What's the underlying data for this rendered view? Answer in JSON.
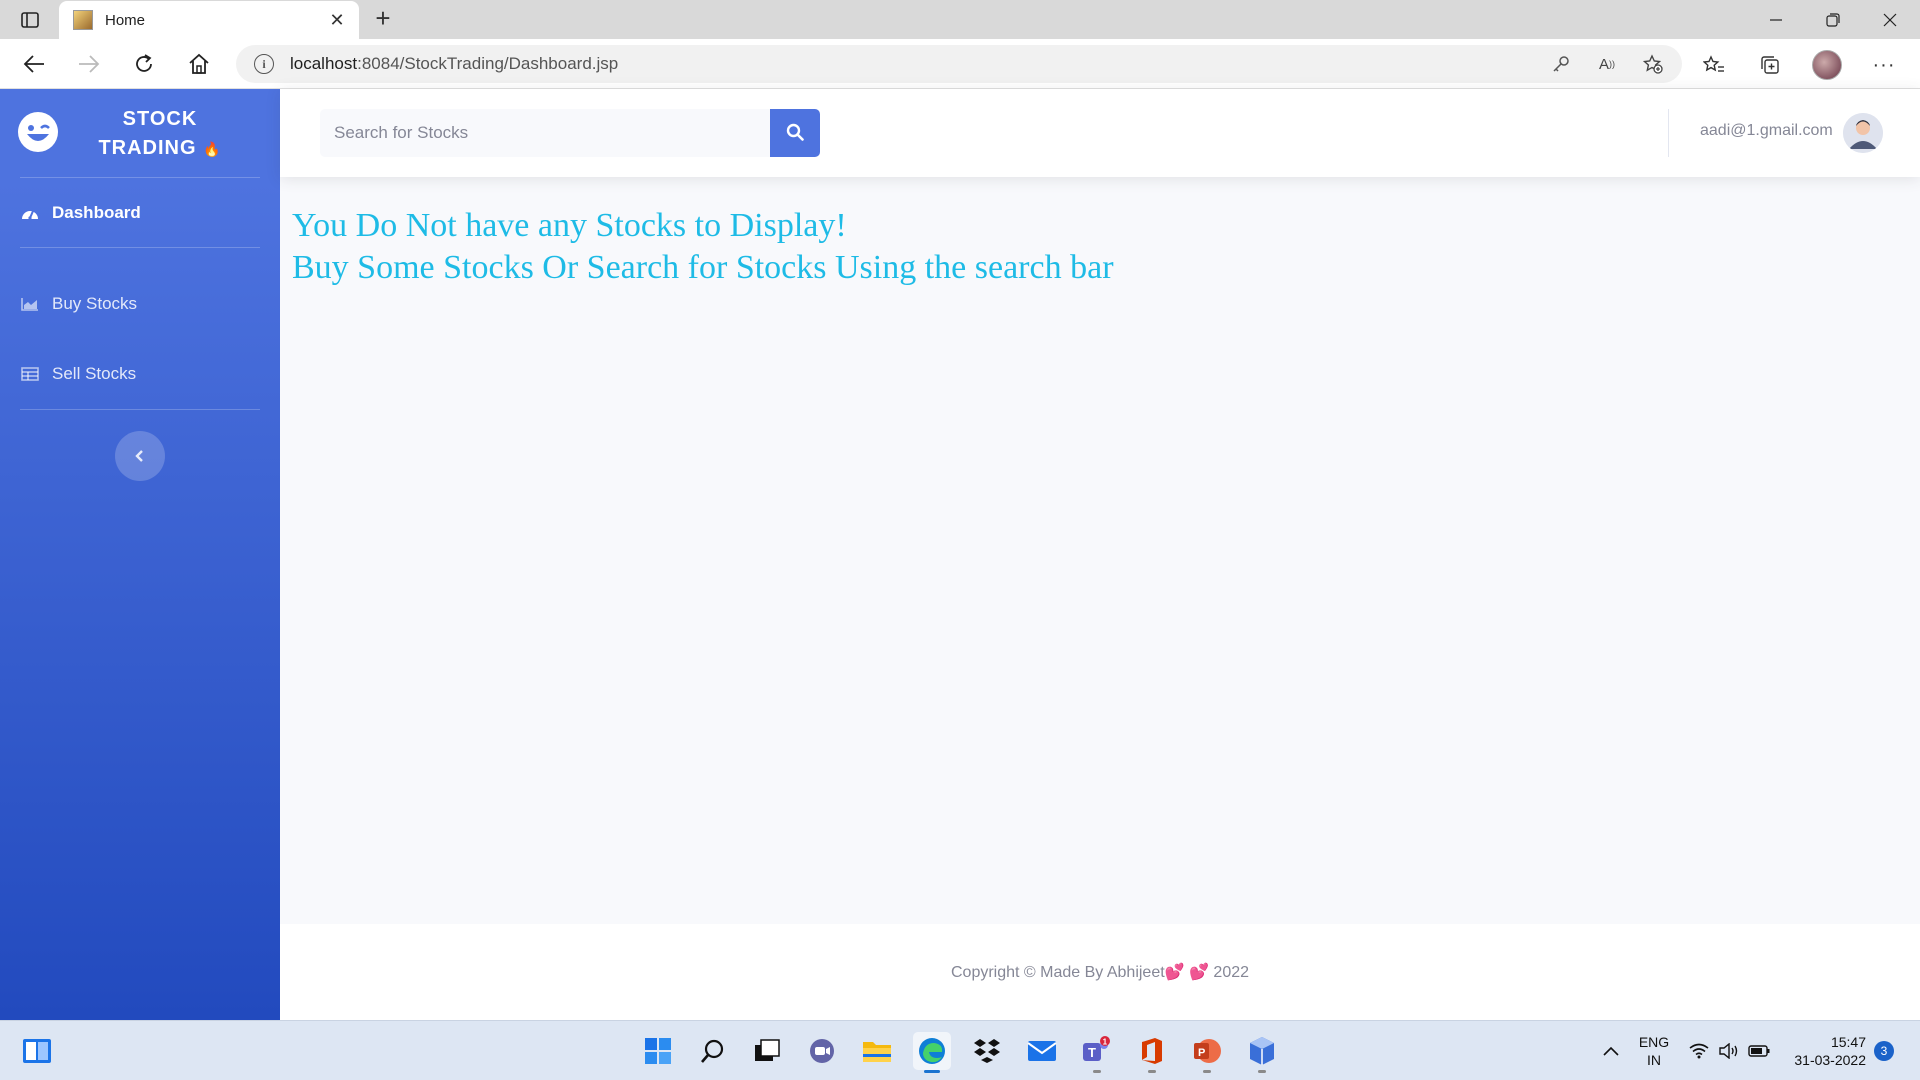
{
  "browser": {
    "tab_title": "Home",
    "url_host": "localhost",
    "url_rest": ":8084/StockTrading/Dashboard.jsp",
    "icons": [
      "tab-actions-icon",
      "close-icon",
      "new-tab-icon",
      "minimize-icon",
      "restore-icon",
      "window-close-icon",
      "back-icon",
      "forward-icon",
      "refresh-icon",
      "home-icon",
      "info-icon",
      "key-icon",
      "read-aloud-icon",
      "add-favorite-icon",
      "favorites-icon",
      "collections-icon",
      "profile-avatar",
      "more-icon"
    ]
  },
  "sidebar": {
    "brand_line1": "STOCK",
    "brand_line2": "TRADING",
    "brand_icon": "laugh-wink-icon",
    "items": [
      {
        "label": "Dashboard",
        "icon": "tachometer-icon"
      },
      {
        "label": "Buy Stocks",
        "icon": "chart-area-icon"
      },
      {
        "label": "Sell Stocks",
        "icon": "table-icon"
      }
    ],
    "toggle_icon": "chevron-left-icon",
    "colors": {
      "gradient_top": "#4e73df",
      "gradient_bottom": "#224abe"
    }
  },
  "topbar": {
    "search_placeholder": "Search for Stocks",
    "search_icon": "search-icon",
    "user_email": "aadi@1.gmail.com"
  },
  "main": {
    "message_line1": "You Do Not have any Stocks to Display!",
    "message_line2": "Buy Some Stocks Or Search for Stocks Using the search bar",
    "message_color": "#1ebbe6"
  },
  "footer": {
    "text_prefix": "Copyright © Made By Abhijeet",
    "hearts": "💕 💕",
    "year": "2022"
  },
  "taskbar": {
    "apps": [
      "widgets-icon",
      "start-icon",
      "search-icon",
      "task-view-icon",
      "chat-icon",
      "file-explorer-icon",
      "edge-icon",
      "dropbox-icon",
      "mail-icon",
      "teams-icon",
      "office-icon",
      "powerpoint-icon",
      "app-icon"
    ],
    "teams_badge": "1",
    "lang_line1": "ENG",
    "lang_line2": "IN",
    "time": "15:47",
    "date": "31-03-2022",
    "notification_count": "3"
  }
}
